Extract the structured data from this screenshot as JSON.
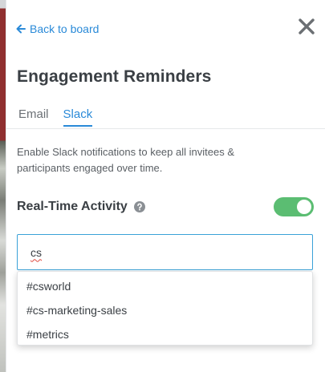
{
  "back_link": {
    "label": "Back to board"
  },
  "title": "Engagement Reminders",
  "tabs": [
    {
      "label": "Email",
      "active": false
    },
    {
      "label": "Slack",
      "active": true
    }
  ],
  "description": "Enable Slack notifications to keep all invitees & participants engaged over time.",
  "real_time_activity": {
    "label": "Real-Time Activity",
    "enabled": true
  },
  "channel_input": {
    "value": "cs"
  },
  "suggestions": [
    "#csworld",
    "#cs-marketing-sales",
    "#metrics"
  ],
  "colors": {
    "accent": "#2a8ad8",
    "toggle_on": "#5bbd72",
    "input_focus_border": "#3aa2d8",
    "spellcheck": "#e0483e"
  },
  "icons": {
    "back": "arrow-left-icon",
    "close": "close-icon",
    "help": "question-circle-icon"
  }
}
